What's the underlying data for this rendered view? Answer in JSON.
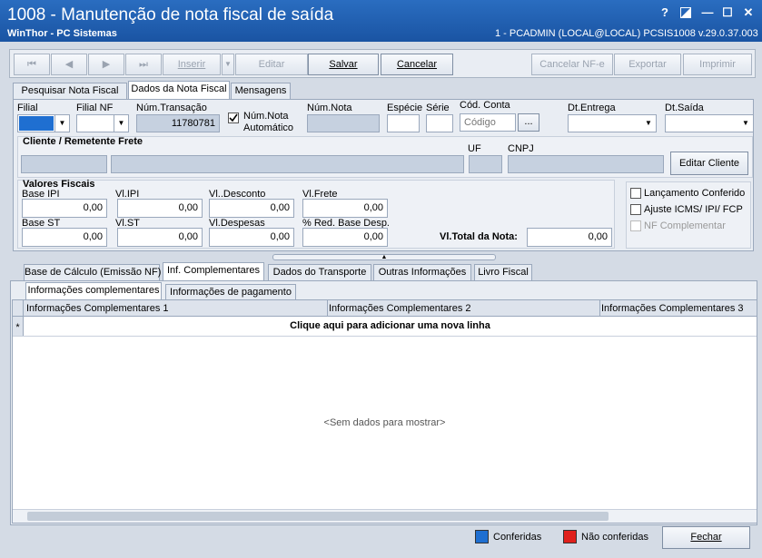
{
  "window": {
    "title": "1008 - Manutenção de nota fiscal de saída",
    "subtitle": "WinThor - PC Sistemas",
    "user_info": "1 - PCADMIN (LOCAL@LOCAL)   PCSIS1008  v.29.0.37.003",
    "help": "?",
    "minimize": "—",
    "maximize": "☐",
    "close": "✕"
  },
  "toolbar": {
    "first": "⏮",
    "prev": "◀",
    "next": "▶",
    "last": "⏭",
    "insert": "Inserir",
    "edit": "Editar",
    "save": "Salvar",
    "cancel": "Cancelar",
    "cancel_nfe": "Cancelar NF-e",
    "export": "Exportar",
    "print": "Imprimir"
  },
  "tabs": [
    "Pesquisar Nota Fiscal",
    "Dados da Nota Fiscal",
    "Mensagens"
  ],
  "form": {
    "filial_label": "Filial",
    "filial_nf_label": "Filial NF",
    "num_transacao_label": "Núm.Transação",
    "num_transacao_value": "11780781",
    "num_nota_auto_line1": "Núm.Nota",
    "num_nota_auto_line2": "Automático",
    "num_nota_label": "Núm.Nota",
    "especie_label": "Espécie",
    "serie_label": "Série",
    "cod_conta_label": "Cód. Conta",
    "cod_conta_placeholder": "Código",
    "browse": "...",
    "dt_entrega_label": "Dt.Entrega",
    "dt_saida_label": "Dt.Saída"
  },
  "cliente": {
    "title": "Cliente / Remetente Frete",
    "uf_label": "UF",
    "cnpj_label": "CNPJ",
    "edit_button": "Editar Cliente"
  },
  "valores": {
    "title": "Valores Fiscais",
    "base_ipi_label": "Base IPI",
    "base_ipi": "0,00",
    "vl_ipi_label": "Vl.IPI",
    "vl_ipi": "0,00",
    "vl_desconto_label": "Vl..Desconto",
    "vl_desconto": "0,00",
    "vl_frete_label": "Vl.Frete",
    "vl_frete": "0,00",
    "base_st_label": "Base ST",
    "base_st": "0,00",
    "vl_st_label": "Vl.ST",
    "vl_st": "0,00",
    "vl_despesas_label": "Vl.Despesas",
    "vl_despesas": "0,00",
    "red_base_label": "% Red. Base Desp.",
    "red_base": "0,00",
    "total_label": "Vl.Total da Nota:",
    "total": "0,00"
  },
  "checks": {
    "lancamento": "Lançamento Conferido",
    "ajuste": "Ajuste ICMS/ IPI/ FCP",
    "nf_complementar": "NF Complementar"
  },
  "subtabs": [
    "Base de Cálculo (Emissão NF)",
    "Inf. Complementares",
    "Dados do Transporte",
    "Outras Informações",
    "Livro Fiscal"
  ],
  "innertabs": [
    "Informações complementares",
    "Informações de pagamento"
  ],
  "grid": {
    "columns": [
      "Informações Complementares 1",
      "Informações Complementares 2",
      "Informações Complementares 3"
    ],
    "new_row_marker": "*",
    "new_row_text": "Clique aqui para adicionar uma nova linha",
    "empty_text": "<Sem dados para mostrar>"
  },
  "footer": {
    "conferidas": "Conferidas",
    "nao_conferidas": "Não conferidas",
    "fechar": "Fechar",
    "color_conferidas": "#1f6fd1",
    "color_nao_conferidas": "#e0201b"
  }
}
